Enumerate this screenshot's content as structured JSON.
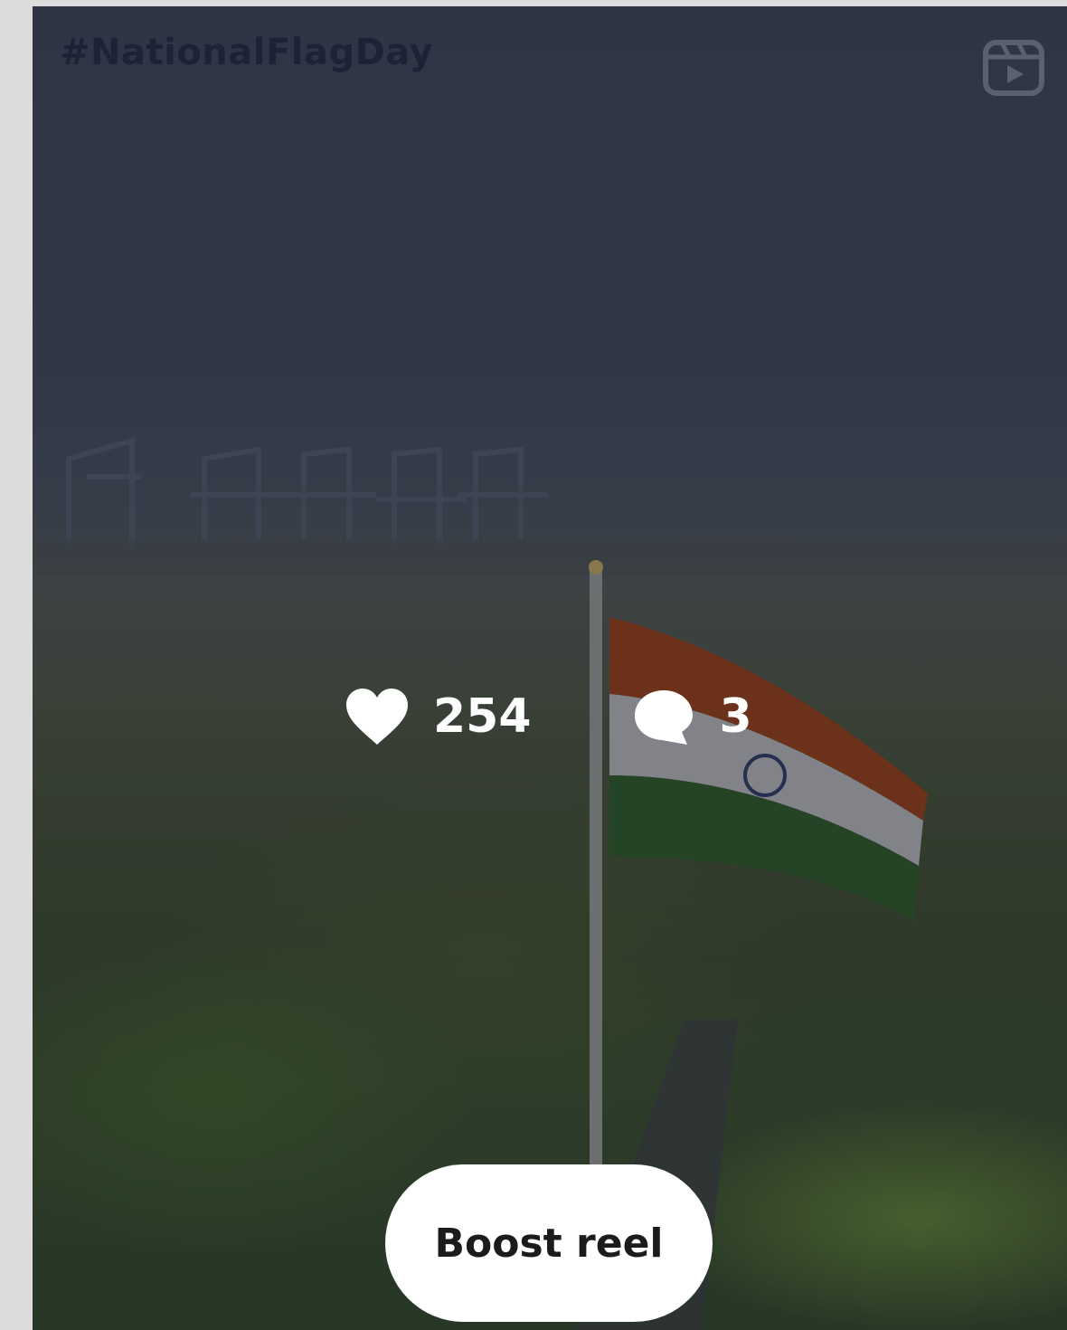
{
  "post": {
    "hashtag": "#NationalFlagDay"
  },
  "stats": {
    "likes": "254",
    "comments": "3"
  },
  "actions": {
    "boost_label": "Boost reel"
  },
  "icons": {
    "reel_type": "reels-icon",
    "likes": "heart-icon",
    "comments": "comment-bubble-icon"
  },
  "colors": {
    "overlay_text": "#ffffff",
    "button_bg": "#ffffff",
    "button_text": "#1b1b1b",
    "hashtag_text": "#1d2337"
  }
}
